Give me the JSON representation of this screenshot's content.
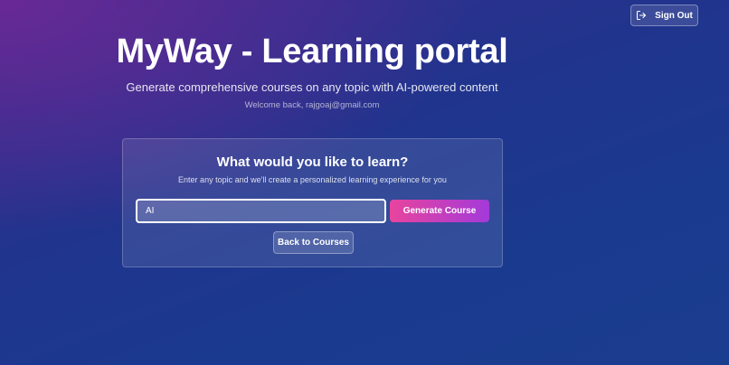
{
  "header": {
    "title": "MyWay - Learning portal",
    "subtitle": "Generate comprehensive courses on any topic with AI-powered content",
    "welcome": "Welcome back, rajgoaj@gmail.com"
  },
  "toolbar": {
    "signout_label": "Sign Out",
    "signout_icon": "sign-out-icon"
  },
  "card": {
    "title": "What would you like to learn?",
    "subtitle": "Enter any topic and we'll create a personalized learning experience for you",
    "topic_value": "AI",
    "generate_label": "Generate Course",
    "back_label": "Back to Courses"
  },
  "colors": {
    "accent_start": "#e8449e",
    "accent_end": "#a33ad9",
    "background": "#1b3d8f"
  }
}
